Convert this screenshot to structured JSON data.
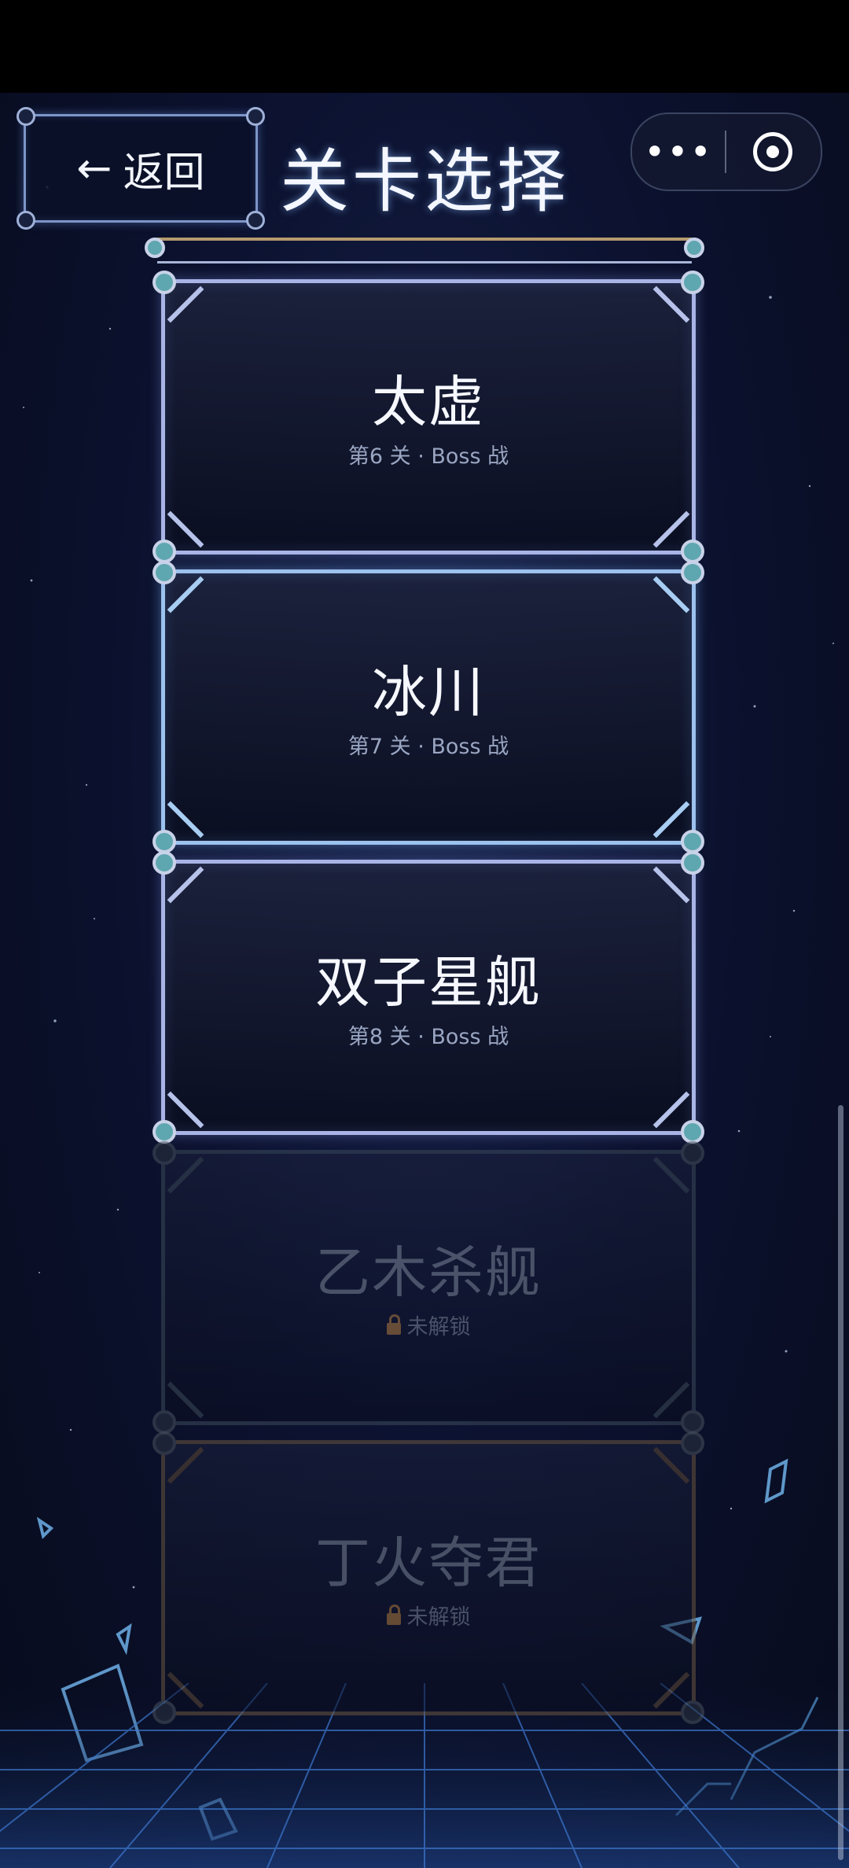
{
  "header": {
    "back_label": "返回",
    "back_arrow": "←",
    "title": "关卡选择"
  },
  "capsule": {
    "more_label": "•••",
    "more_icon": "ellipsis-icon",
    "close_icon": "target-icon"
  },
  "levels": [
    {
      "name": "太虚",
      "subtitle": "第6 关 · Boss 战",
      "locked": false,
      "frame_color": "#a9b4e6"
    },
    {
      "name": "冰川",
      "subtitle": "第7 关 · Boss 战",
      "locked": false,
      "frame_color": "#9cc2ee"
    },
    {
      "name": "双子星舰",
      "subtitle": "第8 关 · Boss 战",
      "locked": false,
      "frame_color": "#a9b4e6"
    },
    {
      "name": "乙木杀舰",
      "subtitle": "未解锁",
      "locked": true,
      "frame_color": "#3b4a58"
    },
    {
      "name": "丁火夺君",
      "subtitle": "未解锁",
      "locked": true,
      "frame_color": "#6a5640"
    }
  ],
  "colors": {
    "background": "#0c1230",
    "accent": "#9cc2ee",
    "lock": "#b07a3c"
  }
}
